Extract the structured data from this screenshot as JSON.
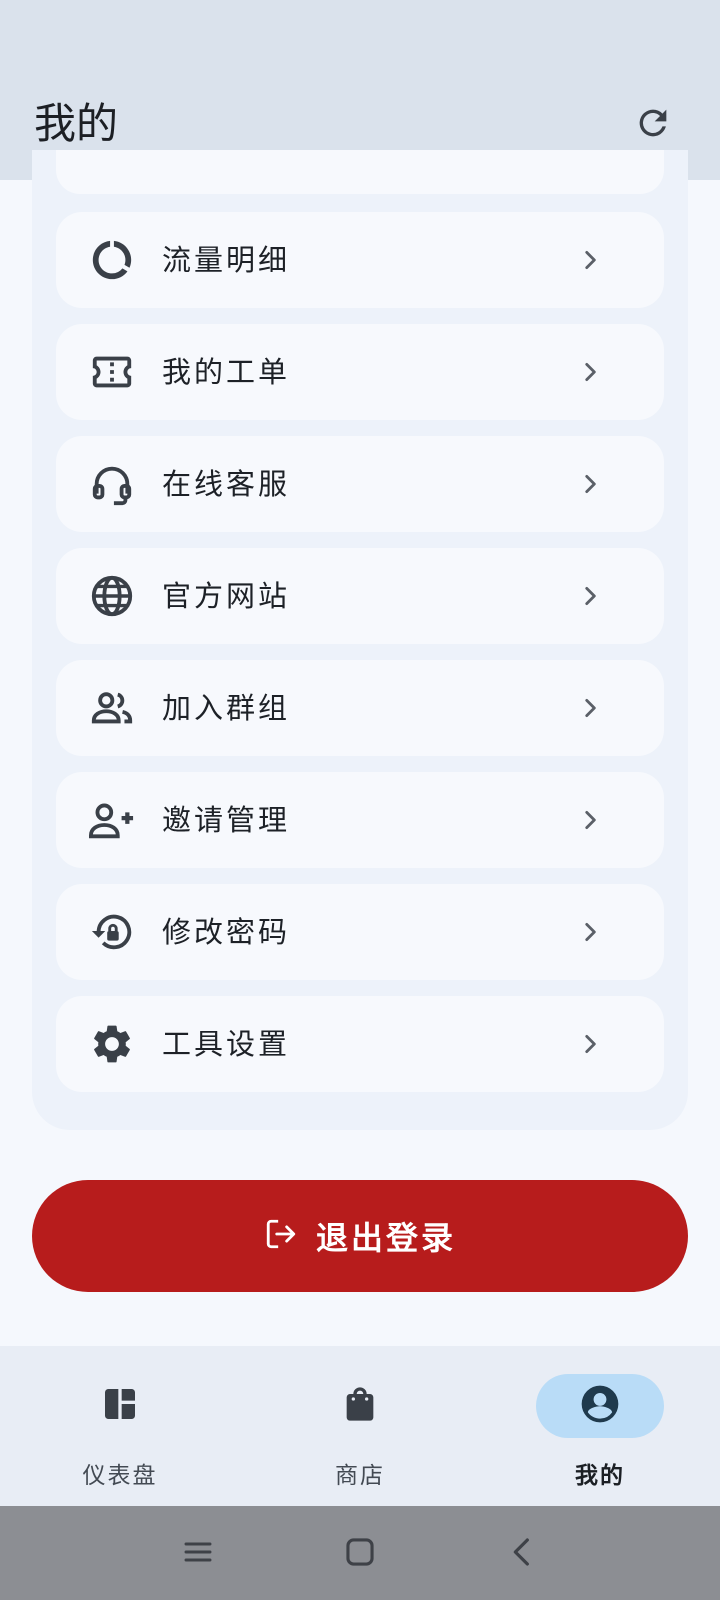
{
  "appbar": {
    "title": "我的",
    "refresh_icon": "refresh-icon"
  },
  "menu": {
    "items": [
      {
        "label": "流量明细",
        "icon": "data-usage-icon"
      },
      {
        "label": "我的工单",
        "icon": "ticket-icon"
      },
      {
        "label": "在线客服",
        "icon": "headset-icon"
      },
      {
        "label": "官方网站",
        "icon": "globe-icon"
      },
      {
        "label": "加入群组",
        "icon": "group-icon"
      },
      {
        "label": "邀请管理",
        "icon": "person-add-icon"
      },
      {
        "label": "修改密码",
        "icon": "lock-reset-icon"
      },
      {
        "label": "工具设置",
        "icon": "gear-icon"
      }
    ]
  },
  "logout": {
    "label": "退出登录",
    "icon": "logout-icon"
  },
  "bottom_nav": {
    "items": [
      {
        "label": "仪表盘",
        "icon": "dashboard-icon",
        "active": false
      },
      {
        "label": "商店",
        "icon": "shopping-bag-icon",
        "active": false
      },
      {
        "label": "我的",
        "icon": "account-circle-icon",
        "active": true
      }
    ]
  },
  "colors": {
    "appbar_bg": "#dae2ec",
    "logout_bg": "#b71c1c",
    "active_pill": "#b9dcf7",
    "icon": "#3a4048"
  },
  "system_nav": [
    "menu-icon",
    "home-icon",
    "back-icon"
  ]
}
